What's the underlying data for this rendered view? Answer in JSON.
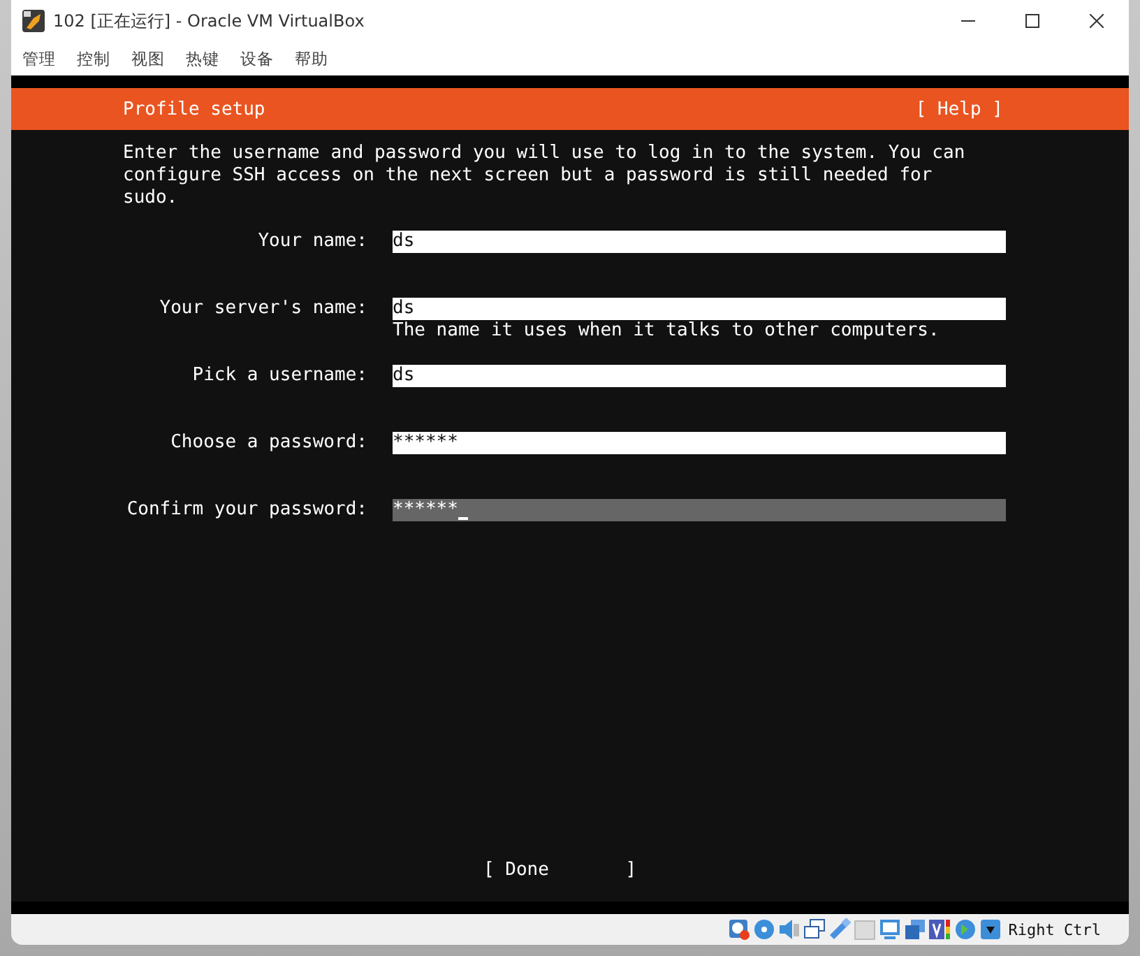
{
  "window": {
    "title": "102 [正在运行] - Oracle VM VirtualBox"
  },
  "menu": [
    "管理",
    "控制",
    "视图",
    "热键",
    "设备",
    "帮助"
  ],
  "screen": {
    "header": {
      "title": "Profile setup",
      "help": "[ Help ]"
    },
    "intro": "Enter the username and password you will use to log in to the system. You can configure SSH access on the next screen but a password is still needed for sudo.",
    "fields": [
      {
        "label": "Your name:",
        "value": "ds",
        "focused": false
      },
      {
        "label": "Your server's name:",
        "value": "ds",
        "focused": false,
        "hint": "The name it uses when it talks to other computers."
      },
      {
        "label": "Pick a username:",
        "value": "ds",
        "focused": false
      },
      {
        "label": "Choose a password:",
        "value": "******",
        "focused": false
      },
      {
        "label": "Confirm your password:",
        "value": "******",
        "focused": true
      }
    ],
    "done_button": "[ Done       ]"
  },
  "status_bar": {
    "host_key": "Right Ctrl"
  }
}
